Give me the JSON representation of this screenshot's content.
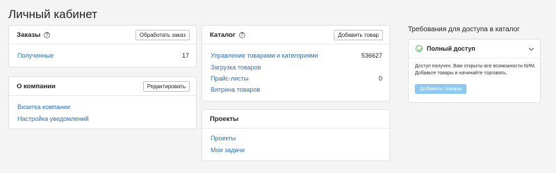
{
  "page": {
    "title": "Личный кабинет"
  },
  "orders": {
    "title": "Заказы",
    "button": "Обработать заказ",
    "rows": [
      {
        "label": "Полученные",
        "value": "17"
      }
    ]
  },
  "company": {
    "title": "О компании",
    "button": "Редактировать",
    "links": [
      "Визитка компании",
      "Настройка уведомлений"
    ]
  },
  "catalog": {
    "title": "Каталог",
    "button": "Добавить товар",
    "rows": [
      {
        "label": "Управление товарами и категориями",
        "value": "536627"
      },
      {
        "label": "Загрузка товаров",
        "value": ""
      },
      {
        "label": "Прайс-листы",
        "value": "0"
      },
      {
        "label": "Витрина товаров",
        "value": ""
      }
    ]
  },
  "projects": {
    "title": "Проекты",
    "links": [
      "Проекты",
      "Мои задачи"
    ]
  },
  "access": {
    "section_title": "Требования для доступа в каталог",
    "status_title": "Полный доступ",
    "description": "Доступ получен. Вам открыты все возможности КИМ. Добавьте товары и начинайте торговать.",
    "button": "Добавить товары"
  },
  "colors": {
    "link": "#2e6db4",
    "primary_button": "#8cc8f0",
    "success": "#4caf50"
  }
}
